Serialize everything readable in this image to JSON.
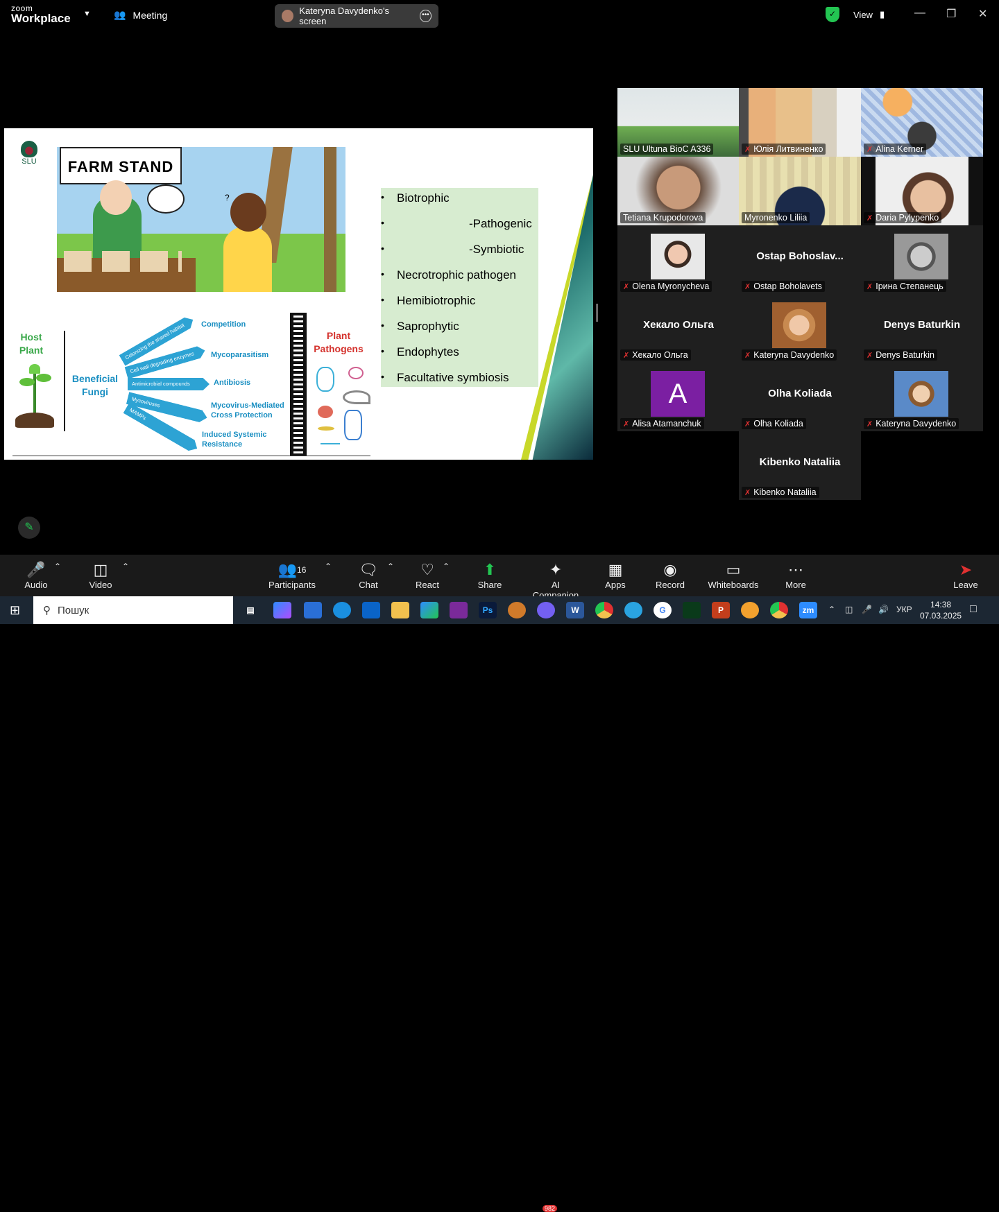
{
  "app": {
    "logo_top": "zoom",
    "logo_bottom": "Workplace",
    "meeting_label": "Meeting",
    "screen_pill": "Kateryna Davydenko's screen",
    "view_label": "View"
  },
  "slide": {
    "logo_text": "SLU",
    "farm_sign": "FARM STAND",
    "bullets": [
      "Biotrophic",
      "-Pathogenic",
      "-Symbiotic",
      "Necrotrophic pathogen",
      "Hemibiotrophic",
      "Saprophytic",
      "Endophytes",
      "Facultative symbiosis"
    ],
    "host_plant": "Host Plant",
    "beneficial_fungi": "Beneficial Fungi",
    "plant_pathogens": "Plant Pathogens",
    "arrows": [
      "Colonizing the shared habitat",
      "Cell wall degrading enzymes",
      "Antimicrobial compounds",
      "Mycoviruses",
      "MAMPs"
    ],
    "arrow_labels": [
      "Competition",
      "Mycoparasitism",
      "Antibiosis",
      "Mycovirus-Mediated Cross Protection",
      "Induced Systemic Resistance"
    ]
  },
  "participants": [
    {
      "name": "SLU Ultuna BioC A336",
      "kind": "video",
      "muted": false
    },
    {
      "name": "Юлія Литвиненко",
      "kind": "video",
      "muted": true
    },
    {
      "name": "Alina Kerner",
      "kind": "video",
      "muted": true
    },
    {
      "name": "Tetiana Krupodorova",
      "kind": "video",
      "muted": false
    },
    {
      "name": "Myronenko Liliia",
      "kind": "video",
      "muted": false
    },
    {
      "name": "Daria Pylypenko",
      "kind": "video",
      "muted": true
    },
    {
      "name": "Olena Myronycheva",
      "kind": "photo",
      "muted": true
    },
    {
      "name": "Ostap Boholavets",
      "display": "Ostap  Bohoslav...",
      "tag": "Ostap Boholavets",
      "kind": "text",
      "muted": true
    },
    {
      "name": "Ірина Степанець",
      "kind": "photo",
      "muted": true
    },
    {
      "name": "Хекало Ольга",
      "display": "Хекало Ольга",
      "kind": "text",
      "muted": true
    },
    {
      "name": "Kateryna Davydenko",
      "kind": "photo",
      "muted": true
    },
    {
      "name": "Denys Baturkin",
      "display": "Denys Baturkin",
      "kind": "text",
      "muted": true
    },
    {
      "name": "Alisa Atamanchuk",
      "kind": "avatar",
      "initial": "A",
      "muted": true
    },
    {
      "name": "Olha Koliada",
      "display": "Olha Koliada",
      "kind": "text",
      "muted": true
    },
    {
      "name": "Kateryna Davydenko",
      "kind": "photo",
      "muted": true
    },
    {
      "name": "Kibenko Nataliia",
      "display": "Kibenko Nataliia",
      "kind": "text",
      "muted": true
    }
  ],
  "toolbar": {
    "audio": "Audio",
    "video": "Video",
    "participants": "Participants",
    "participants_count": "16",
    "chat": "Chat",
    "react": "React",
    "share": "Share",
    "ai": "AI Companion",
    "apps": "Apps",
    "record": "Record",
    "whiteboards": "Whiteboards",
    "more": "More",
    "leave": "Leave"
  },
  "taskbar": {
    "search_placeholder": "Пошук",
    "lang": "УКР",
    "time": "14:38",
    "date": "07.03.2025",
    "viber_badge": "982"
  },
  "colors": {
    "accent": "#23c552",
    "muted": "#e03131",
    "slide_blue": "#2da3d4"
  }
}
